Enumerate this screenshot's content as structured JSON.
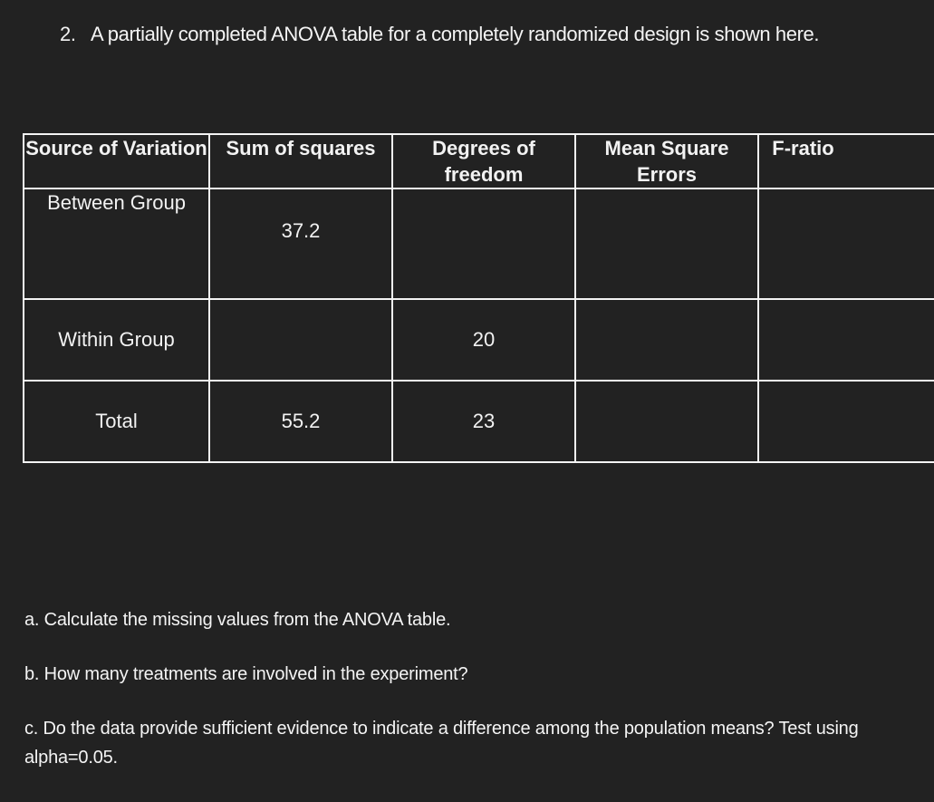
{
  "question": {
    "number": "2.",
    "text": "A partially completed ANOVA table for a completely randomized design is shown here."
  },
  "table": {
    "headers": {
      "source": "Source of Variation",
      "ss": "Sum of squares",
      "df": "Degrees of freedom",
      "ms": "Mean Square Errors",
      "f": "F-ratio"
    },
    "rows": [
      {
        "source": "Between Group",
        "ss": "37.2",
        "df": "",
        "ms": "",
        "f": ""
      },
      {
        "source": "Within Group",
        "ss": "",
        "df": "20",
        "ms": "",
        "f": ""
      },
      {
        "source": "Total",
        "ss": "55.2",
        "df": "23",
        "ms": "",
        "f": ""
      }
    ]
  },
  "sub_questions": {
    "a": "a. Calculate the missing values from the ANOVA table.",
    "b": "b.  How many treatments are involved in the experiment?",
    "c": "c.  Do the data provide sufficient evidence to indicate a difference among the population means? Test using alpha=0.05."
  }
}
